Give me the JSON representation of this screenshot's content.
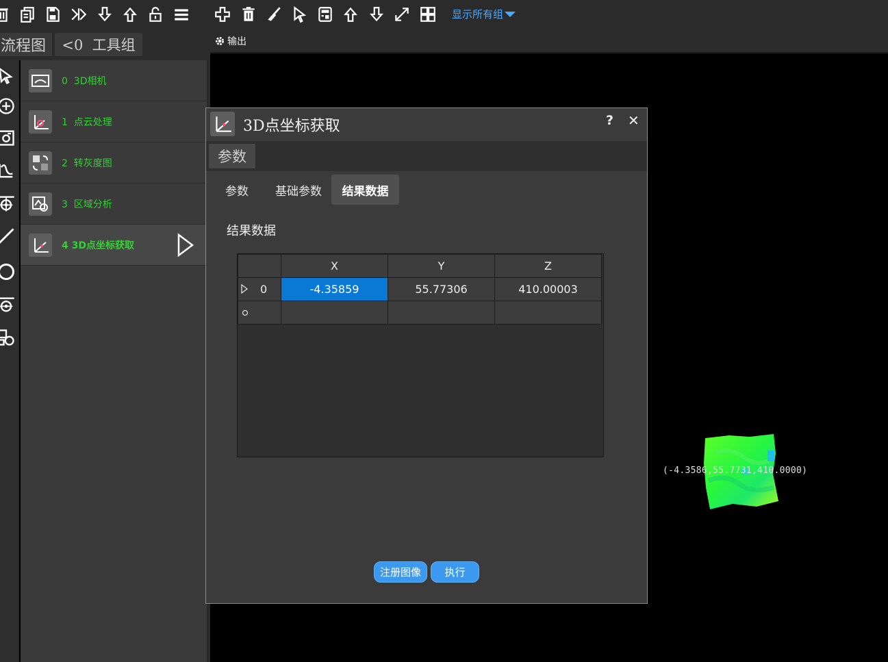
{
  "toolbar": {
    "left_icons": [
      "delete-icon",
      "copy-icon",
      "save-icon",
      "run-continuous-icon",
      "import-icon",
      "export-icon",
      "unlock-icon",
      "menu-icon"
    ],
    "right_icons": [
      "add-icon",
      "trash-icon",
      "clear-icon",
      "pointer-icon",
      "calculator-icon",
      "move-up-icon",
      "move-down-icon",
      "expand-icon",
      "grid-icon"
    ],
    "group_dropdown": "显示所有组"
  },
  "left_panel": {
    "flow_tab": "流程图",
    "group_tab": "<0  工具组",
    "rail_icons": [
      "select-arrow-icon",
      "add-circle-icon",
      "camera-icon",
      "curve-icon",
      "target-icon",
      "line-icon",
      "circle-icon",
      "measure-icon",
      "shapes-icon"
    ],
    "flow_items": [
      {
        "label": "0  3D相机"
      },
      {
        "label": "1  点云处理"
      },
      {
        "label": "2  转灰度图"
      },
      {
        "label": "3  区域分析"
      },
      {
        "label": "4 3D点坐标获取"
      }
    ]
  },
  "output": {
    "label": "输出",
    "coord_readout": "(-4.3586,55.7731,410.0000)"
  },
  "dialog": {
    "title": "3D点坐标获取",
    "help": "?",
    "close": "✕",
    "section_tab": "参数",
    "subtabs": [
      "参数",
      "基础参数",
      "结果数据"
    ],
    "active_subtab": "结果数据",
    "heading": "结果数据",
    "table": {
      "columns": [
        "X",
        "Y",
        "Z"
      ],
      "rows": [
        {
          "index": "0",
          "x": "-4.35859",
          "y": "55.77306",
          "z": "410.00003"
        }
      ]
    },
    "buttons": {
      "register": "注册图像",
      "execute": "执行"
    }
  },
  "colors": {
    "accent": "#3b99f0",
    "flow_text": "#31d231",
    "selected_cell": "#0a79d6",
    "dropdown_text": "#4aa8ff"
  }
}
